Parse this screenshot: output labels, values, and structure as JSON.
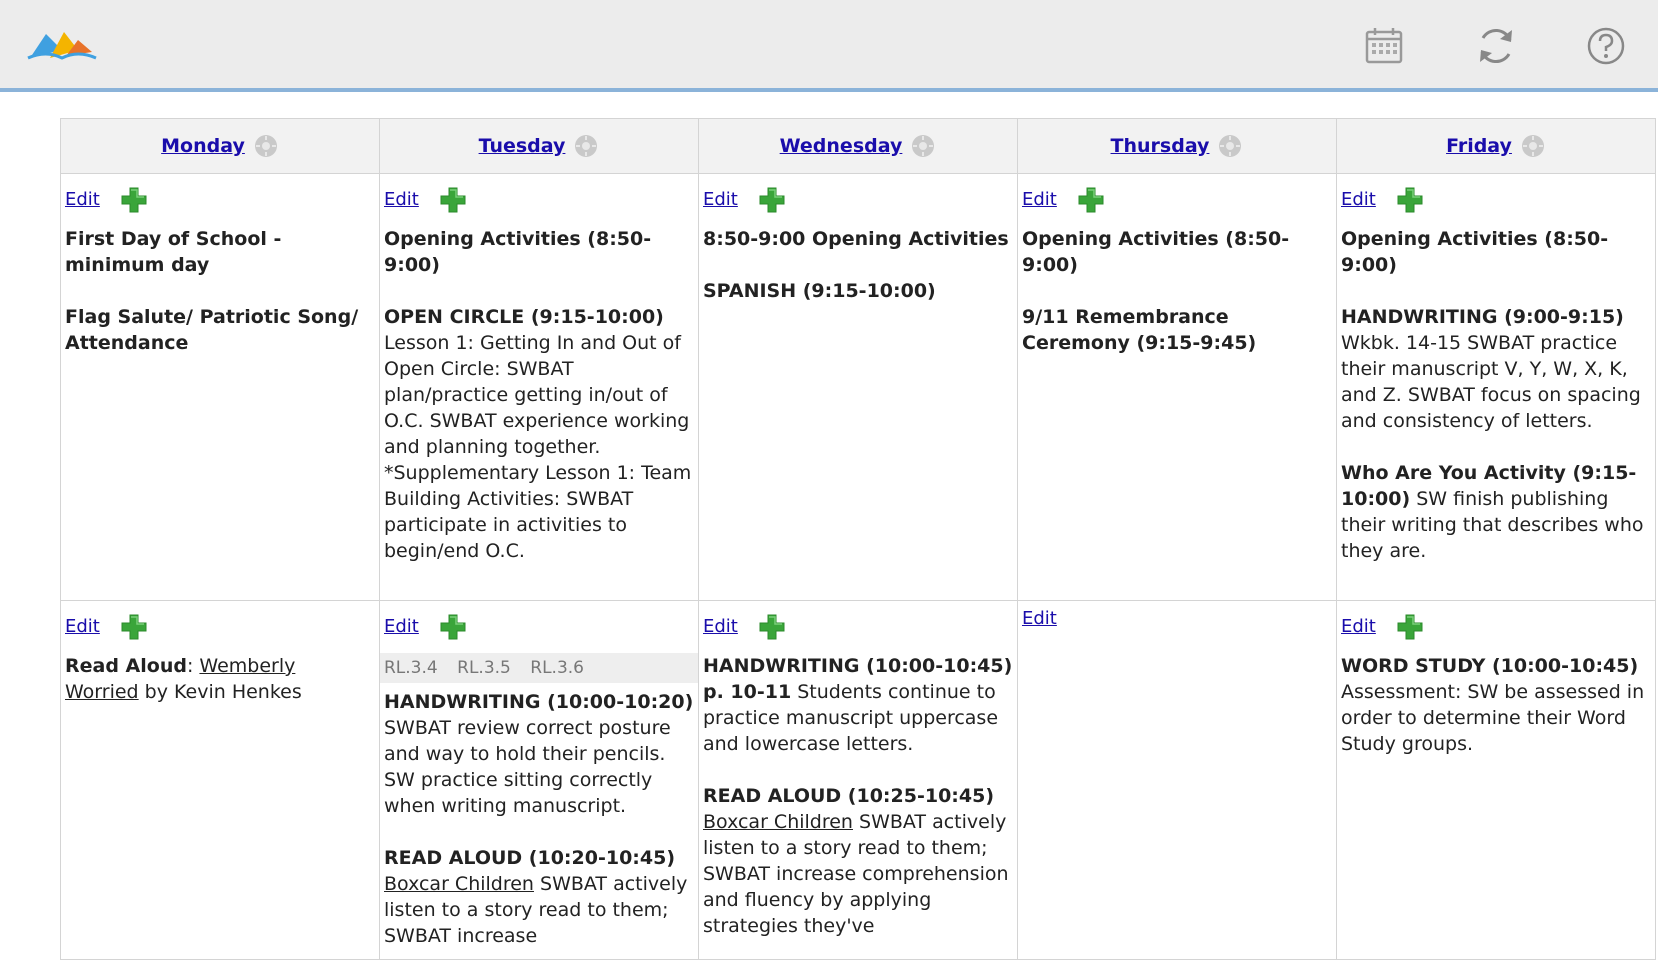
{
  "header": {
    "icons": [
      "book-logo-icon",
      "calendar-icon",
      "refresh-icon",
      "help-icon"
    ]
  },
  "days": [
    {
      "name": "Monday"
    },
    {
      "name": "Tuesday"
    },
    {
      "name": "Wednesday"
    },
    {
      "name": "Thursday"
    },
    {
      "name": "Friday"
    }
  ],
  "edit_label": "Edit",
  "row1": {
    "mon": {
      "b1": "First Day of School - minimum day",
      "b2": "Flag Salute/ Patriotic Song/ Attendance"
    },
    "tue": {
      "b1": "Opening Activities (8:50-9:00)",
      "b2_title": "OPEN CIRCLE (9:15-10:00)",
      "b2_text": "Lesson 1: Getting In and Out of Open Circle: SWBAT plan/practice getting in/out of O.C.   SWBAT experience working and planning together. *Supplementary Lesson 1: Team Building Activities: SWBAT participate in activities to begin/end O.C."
    },
    "wed": {
      "b1": "8:50-9:00 Opening Activities",
      "b2": "SPANISH (9:15-10:00)"
    },
    "thu": {
      "b1": "Opening Activities (8:50-9:00)",
      "b2": "9/11 Remembrance Ceremony (9:15-9:45)"
    },
    "fri": {
      "b1": "Opening Activities (8:50-9:00)",
      "b2_title": "HANDWRITING (9:00-9:15)",
      "b2_text": "Wkbk. 14-15 SWBAT practice their manuscript V, Y, W, X, K, and Z. SWBAT focus on spacing and consistency of letters.",
      "b3_title": "Who Are You Activity (9:15-10:00)",
      "b3_text": " SW finish publishing their writing that describes who they are."
    }
  },
  "row2": {
    "mon": {
      "label": "Read Aloud",
      "sep": ": ",
      "book": "Wemberly Worried",
      "rest": " by Kevin Henkes"
    },
    "tue": {
      "standards": "RL.3.4 RL.3.5 RL.3.6",
      "b1_title": "HANDWRITING (10:00-10:20)",
      "b1_text": "SWBAT review correct posture and way to hold their pencils. SW practice sitting correctly when writing manuscript.",
      "b2_title": "READ ALOUD (10:20-10:45)",
      "b2_book": "Boxcar Children",
      "b2_text": " SWBAT actively listen to a story read to them; SWBAT increase"
    },
    "wed": {
      "b1_title": "HANDWRITING (10:00-10:45) p. 10-11",
      "b1_text": " Students continue to practice manuscript uppercase and lowercase letters.",
      "b2_title": "READ ALOUD (10:25-10:45)",
      "b2_book": "Boxcar Children",
      "b2_text": " SWBAT actively listen to a story read to them; SWBAT increase comprehension and fluency by applying strategies they've"
    },
    "fri": {
      "b1_title": "WORD STUDY (10:00-10:45)",
      "b1_text": " Assessment: SW be assessed in order to determine their Word Study groups."
    }
  },
  "colors": {
    "link": "#1a0dab",
    "header_rule": "#8bb3d9",
    "add_icon": "#3aa53a"
  }
}
